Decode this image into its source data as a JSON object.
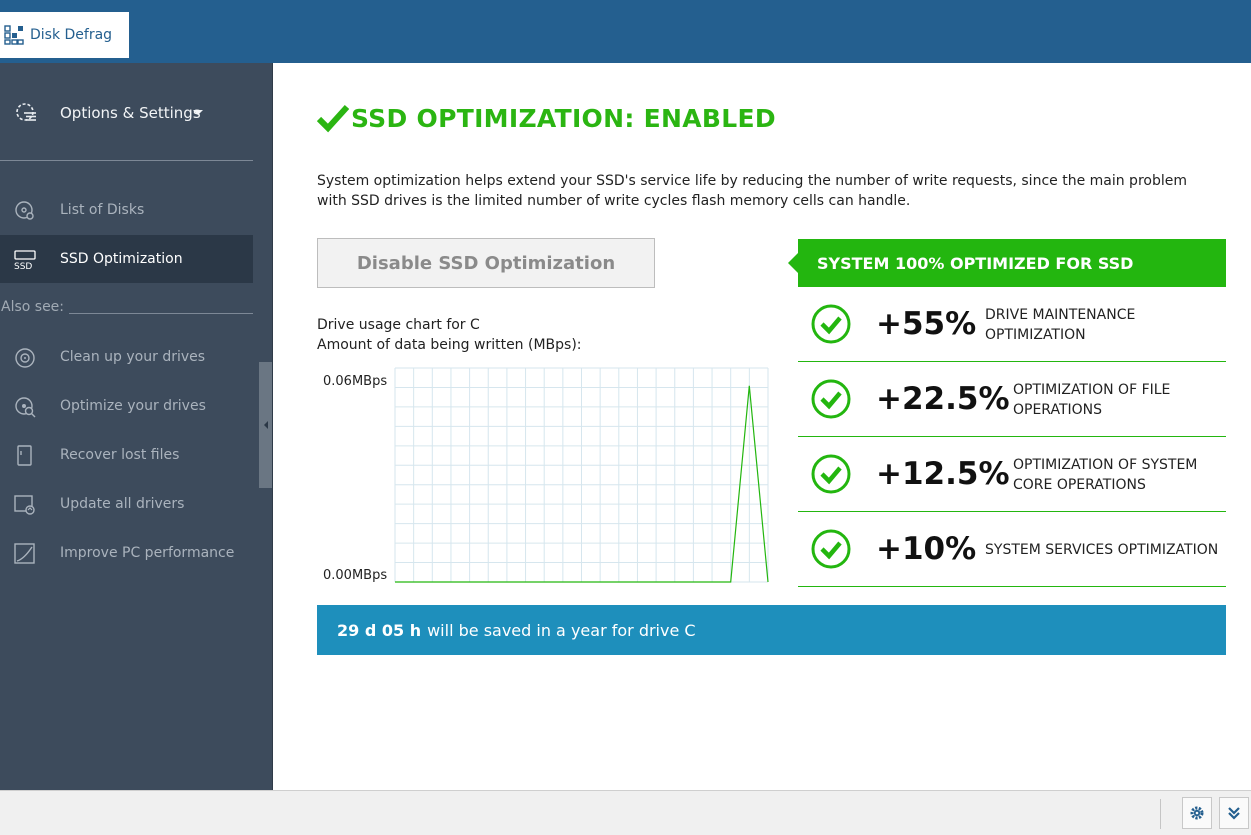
{
  "tab": {
    "label": "Disk Defrag"
  },
  "sidebar": {
    "options_label": "Options & Settings",
    "items": [
      {
        "label": "List of Disks"
      },
      {
        "label": "SSD Optimization"
      }
    ],
    "also_see": "Also see:",
    "links": [
      {
        "label": "Clean up your drives"
      },
      {
        "label": "Optimize your drives"
      },
      {
        "label": "Recover lost files"
      },
      {
        "label": "Update all drivers"
      },
      {
        "label": "Improve PC performance"
      }
    ]
  },
  "main": {
    "title": "SSD OPTIMIZATION: ENABLED",
    "description": "System optimization helps extend your SSD's service life by reducing the number of write requests, since the main problem with SSD drives is the limited number of write cycles flash memory cells can handle.",
    "disable_button": "Disable SSD Optimization",
    "chart_title_line1": "Drive usage chart for C",
    "chart_title_line2": "Amount of data being written (MBps):",
    "system_banner": "SYSTEM 100% OPTIMIZED FOR SSD",
    "optimizations": [
      {
        "percent": "+55%",
        "label": "DRIVE MAINTENANCE OPTIMIZATION"
      },
      {
        "percent": "+22.5%",
        "label": "OPTIMIZATION OF FILE OPERATIONS"
      },
      {
        "percent": "+12.5%",
        "label": "OPTIMIZATION OF SYSTEM CORE OPERATIONS"
      },
      {
        "percent": "+10%",
        "label": "SYSTEM SERVICES OPTIMIZATION"
      }
    ],
    "saved_time": "29 d 05 h",
    "saved_text": "will be saved in a year for drive C"
  },
  "chart_data": {
    "type": "line",
    "title": "",
    "ylabel": "",
    "ylim": [
      0,
      0.06
    ],
    "y_tick_labels": [
      "0.06MBps",
      "0.00MBps"
    ],
    "series": [
      {
        "x": [
          0,
          1,
          2,
          3,
          4,
          5,
          6,
          7,
          8,
          9,
          10,
          11,
          12,
          13,
          14,
          15,
          16,
          17,
          18,
          19,
          20
        ],
        "values": [
          0,
          0,
          0,
          0,
          0,
          0,
          0,
          0,
          0,
          0,
          0,
          0,
          0,
          0,
          0,
          0,
          0,
          0,
          0,
          0.055,
          0
        ]
      }
    ]
  },
  "colors": {
    "accent_green": "#23b60f",
    "title_green": "#2bb512",
    "info_blue": "#1e8fbc",
    "sidebar_bg": "#3d4b5c",
    "topbar_blue": "#245f8f"
  }
}
